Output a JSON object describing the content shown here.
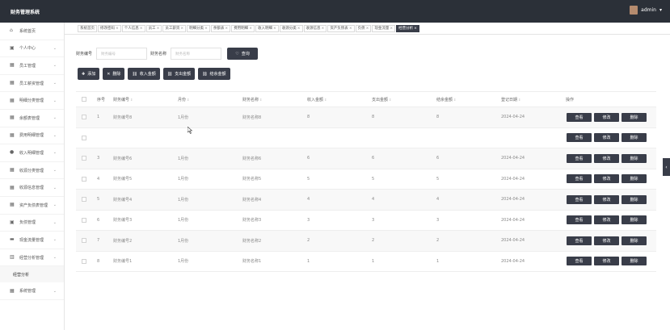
{
  "app": {
    "title": "财务管理系统"
  },
  "user": {
    "name": "admin"
  },
  "sidebar": {
    "items": [
      {
        "label": "系统首页",
        "icon": "home-icon",
        "expandable": false
      },
      {
        "label": "个人中心",
        "icon": "calendar-icon",
        "expandable": true
      },
      {
        "label": "员工管理",
        "icon": "grid-icon",
        "expandable": true
      },
      {
        "label": "员工薪资管理",
        "icon": "grid-icon",
        "expandable": true
      },
      {
        "label": "明细分类管理",
        "icon": "grid-icon",
        "expandable": true
      },
      {
        "label": "余额表管理",
        "icon": "grid-icon",
        "expandable": true
      },
      {
        "label": "费用明细管理",
        "icon": "grid-icon",
        "expandable": true
      },
      {
        "label": "收入明细管理",
        "icon": "person-icon",
        "expandable": true
      },
      {
        "label": "收源分类管理",
        "icon": "grid-icon",
        "expandable": true
      },
      {
        "label": "收源信息管理",
        "icon": "grid-icon",
        "expandable": true
      },
      {
        "label": "资产负债表管理",
        "icon": "grid-icon",
        "expandable": true
      },
      {
        "label": "负债管理",
        "icon": "calendar-icon",
        "expandable": true
      },
      {
        "label": "现金流量管理",
        "icon": "card-icon",
        "expandable": true
      },
      {
        "label": "经营分析管理",
        "icon": "chart-icon",
        "expandable": true
      }
    ],
    "submenu": [
      "经营分析"
    ],
    "after": [
      {
        "label": "系统管理",
        "icon": "grid-icon",
        "expandable": true
      }
    ]
  },
  "tabs": [
    {
      "label": "系统首页",
      "closable": false
    },
    {
      "label": "修改密码",
      "closable": true
    },
    {
      "label": "个人信息",
      "closable": true
    },
    {
      "label": "员工",
      "closable": true
    },
    {
      "label": "员工薪资",
      "closable": true
    },
    {
      "label": "明细分类",
      "closable": true
    },
    {
      "label": "余额表",
      "closable": true
    },
    {
      "label": "费用明细",
      "closable": true
    },
    {
      "label": "收入明细",
      "closable": true
    },
    {
      "label": "收源分类",
      "closable": true
    },
    {
      "label": "收源信息",
      "closable": true
    },
    {
      "label": "资产负债表",
      "closable": true
    },
    {
      "label": "负债",
      "closable": true
    },
    {
      "label": "现金流量",
      "closable": true
    },
    {
      "label": "经营分析",
      "closable": true,
      "active": true
    }
  ],
  "search": {
    "field1_label": "财务编号",
    "field1_placeholder": "财务编号",
    "field2_label": "财务名称",
    "field2_placeholder": "财务名称",
    "button": "查询"
  },
  "actions": [
    "添加",
    "删除",
    "收入金额",
    "支出金额",
    "结余金额"
  ],
  "table": {
    "headers": [
      "序号",
      "财务编号",
      "月份",
      "财务名称",
      "收入金额",
      "支出金额",
      "结余金额",
      "登记日期",
      "操作"
    ],
    "ops": [
      "查看",
      "修改",
      "删除"
    ],
    "rows": [
      [
        "1",
        "财务编号8",
        "1月份",
        "财务名称8",
        "8",
        "8",
        "8",
        "2024-04-24"
      ],
      [
        "",
        "",
        "",
        "",
        "",
        "",
        "",
        ""
      ],
      [
        "3",
        "财务编号6",
        "1月份",
        "财务名称6",
        "6",
        "6",
        "6",
        "2024-04-24"
      ],
      [
        "4",
        "财务编号5",
        "1月份",
        "财务名称5",
        "5",
        "5",
        "5",
        "2024-04-24"
      ],
      [
        "5",
        "财务编号4",
        "1月份",
        "财务名称4",
        "4",
        "4",
        "4",
        "2024-04-24"
      ],
      [
        "6",
        "财务编号3",
        "1月份",
        "财务名称3",
        "3",
        "3",
        "3",
        "2024-04-24"
      ],
      [
        "7",
        "财务编号2",
        "1月份",
        "财务名称2",
        "2",
        "2",
        "2",
        "2024-04-24"
      ],
      [
        "8",
        "财务编号1",
        "1月份",
        "财务名称1",
        "1",
        "1",
        "1",
        "2024-04-24"
      ]
    ]
  }
}
